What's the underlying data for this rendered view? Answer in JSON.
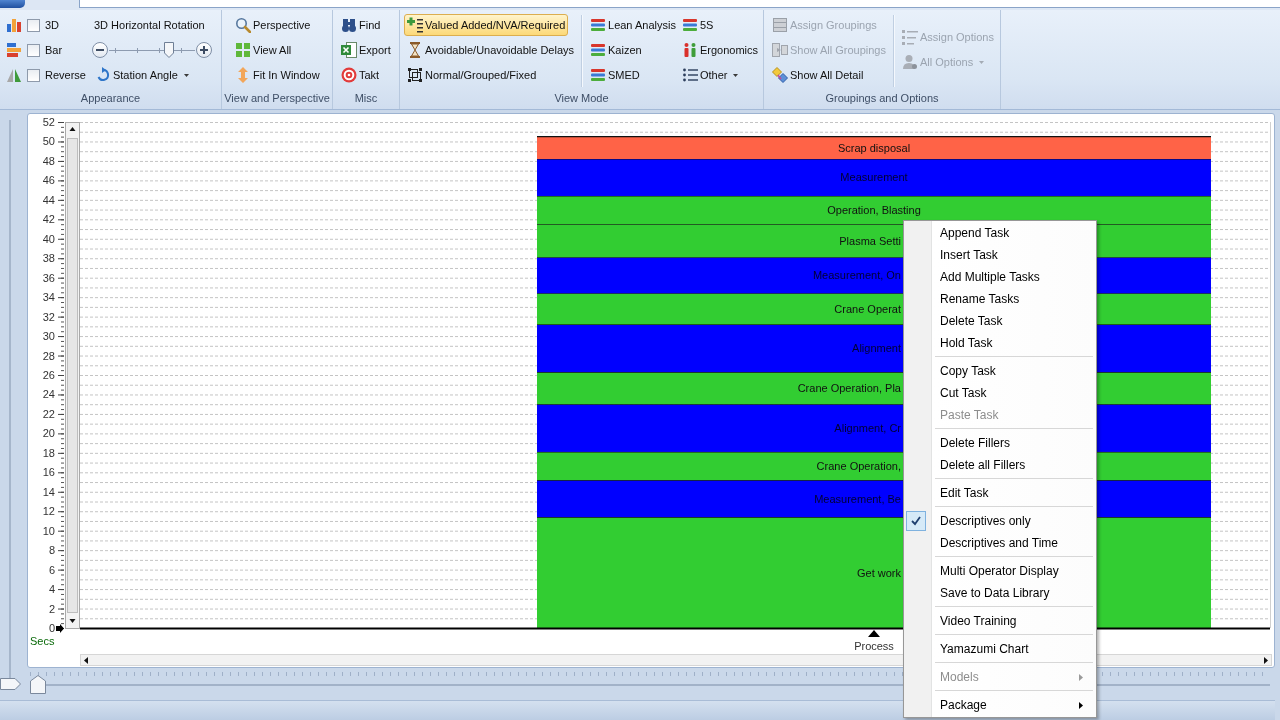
{
  "ribbon": {
    "appearance": {
      "label": "Appearance",
      "checkboxes": [
        {
          "label": "3D",
          "checked": false
        },
        {
          "label": "Bar",
          "checked": false
        },
        {
          "label": "Reverse",
          "checked": false
        }
      ],
      "rotation": {
        "label": "3D Horizontal Rotation",
        "level": 0.7
      },
      "station_angle": {
        "label": "Station Angle",
        "kind": "dropdown"
      }
    },
    "view_and_perspective": {
      "label": "View and Perspective",
      "buttons": [
        {
          "label": "Perspective"
        },
        {
          "label": "View All"
        },
        {
          "label": "Fit In Window"
        }
      ]
    },
    "misc": {
      "label": "Misc",
      "buttons": [
        {
          "label": "Find"
        },
        {
          "label": "Export"
        },
        {
          "label": "Takt"
        }
      ]
    },
    "view_mode": {
      "label": "View Mode",
      "modes": [
        {
          "label": "Valued Added/NVA/Required",
          "kind": "toggle",
          "selected": true
        },
        {
          "label": "Avoidable/Unavoidable Delays",
          "kind": "toggle",
          "selected": false
        },
        {
          "label": "Normal/Grouped/Fixed",
          "kind": "toggle",
          "selected": false
        },
        {
          "label": "Lean Analysis",
          "kind": "toggle",
          "selected": false
        },
        {
          "label": "Kaizen",
          "kind": "toggle",
          "selected": false
        },
        {
          "label": "SMED",
          "kind": "toggle",
          "selected": false
        },
        {
          "label": "5S",
          "kind": "toggle",
          "selected": false
        },
        {
          "label": "Ergonomics",
          "kind": "toggle",
          "selected": false
        },
        {
          "label": "Other",
          "kind": "dropdown",
          "selected": false
        }
      ]
    },
    "groupings_and_options": {
      "label": "Groupings and Options",
      "buttons": [
        {
          "label": "Assign Groupings",
          "kind": "button",
          "disabled": true
        },
        {
          "label": "Show All Groupings",
          "kind": "button",
          "disabled": true
        },
        {
          "label": "Show All Detail",
          "kind": "button",
          "disabled": false
        },
        {
          "label": "Assign Options",
          "kind": "button",
          "disabled": true
        },
        {
          "label": "All Options",
          "kind": "dropdown",
          "disabled": true
        }
      ]
    }
  },
  "vertical_slider": {
    "level": 0
  },
  "chart": {
    "chart_data": {
      "type": "bar",
      "stacked": true,
      "grid": true,
      "categories": [
        "Process"
      ],
      "ylabel": "Secs",
      "ylim": [
        0,
        52
      ],
      "yticks": [
        0,
        2,
        4,
        6,
        8,
        10,
        12,
        14,
        16,
        18,
        20,
        22,
        24,
        26,
        28,
        30,
        32,
        34,
        36,
        38,
        40,
        42,
        44,
        46,
        48,
        50,
        52
      ],
      "series": [
        {
          "name": "Get work",
          "color": "#32cd32",
          "values": [
            11.4
          ]
        },
        {
          "name": "Measurement, Be",
          "color": "#0000ff",
          "values": [
            3.8
          ]
        },
        {
          "name": "Crane Operation,",
          "color": "#32cd32",
          "values": [
            2.9
          ]
        },
        {
          "name": "Alignment, Cr",
          "color": "#0000ff",
          "values": [
            4.9
          ]
        },
        {
          "name": "Crane Operation, Pla",
          "color": "#32cd32",
          "values": [
            3.3
          ]
        },
        {
          "name": "Alignment",
          "color": "#0000ff",
          "values": [
            4.9
          ]
        },
        {
          "name": "Crane Operat",
          "color": "#32cd32",
          "values": [
            3.2
          ]
        },
        {
          "name": "Measurement, On",
          "color": "#0000ff",
          "values": [
            3.7
          ]
        },
        {
          "name": "Plasma Setti",
          "color": "#32cd32",
          "values": [
            3.4
          ]
        },
        {
          "name": "Operation, Blasting",
          "color": "#32cd32",
          "values": [
            2.9
          ]
        },
        {
          "name": "Measurement",
          "color": "#0000ff",
          "values": [
            3.8
          ]
        },
        {
          "name": "Scrap disposal",
          "color": "#ff6347",
          "values": [
            2.3
          ]
        }
      ]
    }
  },
  "horizontal_slider": {
    "level": 0
  },
  "context_menu": {
    "groups": [
      {
        "items": [
          {
            "label": "Append Task",
            "checked": false,
            "disabled": false,
            "submenu": false
          },
          {
            "label": "Insert Task",
            "checked": false,
            "disabled": false,
            "submenu": false
          },
          {
            "label": "Add Multiple Tasks",
            "checked": false,
            "disabled": false,
            "submenu": false
          },
          {
            "label": "Rename Tasks",
            "checked": false,
            "disabled": false,
            "submenu": false
          },
          {
            "label": "Delete Task",
            "checked": false,
            "disabled": false,
            "submenu": false
          },
          {
            "label": "Hold Task",
            "checked": false,
            "disabled": false,
            "submenu": false
          }
        ]
      },
      {
        "items": [
          {
            "label": "Copy Task",
            "checked": false,
            "disabled": false,
            "submenu": false
          },
          {
            "label": "Cut Task",
            "checked": false,
            "disabled": false,
            "submenu": false
          },
          {
            "label": "Paste Task",
            "checked": false,
            "disabled": true,
            "submenu": false
          }
        ]
      },
      {
        "items": [
          {
            "label": "Delete Fillers",
            "checked": false,
            "disabled": false,
            "submenu": false
          },
          {
            "label": "Delete all Fillers",
            "checked": false,
            "disabled": false,
            "submenu": false
          }
        ]
      },
      {
        "items": [
          {
            "label": "Edit Task",
            "checked": false,
            "disabled": false,
            "submenu": false
          }
        ]
      },
      {
        "items": [
          {
            "label": "Descriptives only",
            "checked": true,
            "disabled": false,
            "submenu": false
          },
          {
            "label": "Descriptives and Time",
            "checked": false,
            "disabled": false,
            "submenu": false
          }
        ]
      },
      {
        "items": [
          {
            "label": "Multi Operator Display",
            "checked": false,
            "disabled": false,
            "submenu": false
          },
          {
            "label": "Save to Data Library",
            "checked": false,
            "disabled": false,
            "submenu": false
          }
        ]
      },
      {
        "items": [
          {
            "label": "Video Training",
            "checked": false,
            "disabled": false,
            "submenu": false
          }
        ]
      },
      {
        "items": [
          {
            "label": "Yamazumi Chart",
            "checked": false,
            "disabled": false,
            "submenu": false
          }
        ]
      },
      {
        "items": [
          {
            "label": "Models",
            "checked": false,
            "disabled": true,
            "submenu": true
          }
        ]
      },
      {
        "items": [
          {
            "label": "Package",
            "checked": false,
            "disabled": false,
            "submenu": true
          }
        ]
      }
    ]
  }
}
